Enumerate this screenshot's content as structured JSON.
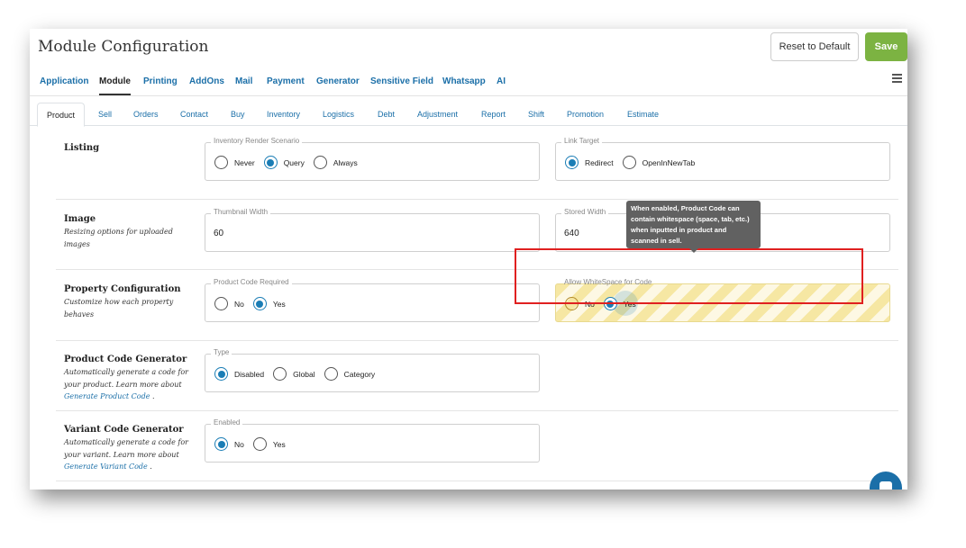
{
  "header": {
    "title": "Module Configuration",
    "reset_label": "Reset to Default",
    "save_label": "Save",
    "save_color": "#7cb342"
  },
  "topnav": {
    "items": [
      "Application",
      "Module",
      "Printing",
      "AddOns",
      "Mail",
      "Payment",
      "Generator",
      "Sensitive Field",
      "Whatsapp",
      "AI"
    ],
    "active": "Module",
    "menu_icon": "hamburger-icon"
  },
  "subtabs": {
    "items": [
      "Product",
      "Sell",
      "Orders",
      "Contact",
      "Buy",
      "Inventory",
      "Logistics",
      "Debt",
      "Adjustment",
      "Report",
      "Shift",
      "Promotion",
      "Estimate"
    ],
    "active": "Product"
  },
  "sections": {
    "listing": {
      "title": "Listing",
      "inventory_render": {
        "label": "Inventory Render Scenario",
        "options": [
          "Never",
          "Query",
          "Always"
        ],
        "selected": "Query"
      },
      "link_target": {
        "label": "Link Target",
        "options": [
          "Redirect",
          "OpenInNewTab"
        ],
        "selected": "Redirect"
      }
    },
    "image": {
      "title": "Image",
      "desc": "Resizing options for uploaded images",
      "thumbnail": {
        "label": "Thumbnail Width",
        "value": "60"
      },
      "stored": {
        "label": "Stored Width",
        "value": "640"
      }
    },
    "property": {
      "title": "Property Configuration",
      "desc": "Customize how each property behaves",
      "code_required": {
        "label": "Product Code Required",
        "options": [
          "No",
          "Yes"
        ],
        "selected": "Yes"
      },
      "whitespace": {
        "label": "Allow WhiteSpace for Code",
        "options": [
          "No",
          "Yes"
        ],
        "selected": "Yes"
      },
      "tooltip": "When enabled, Product Code can contain whitespace (space, tab, etc.) when inputted in product and scanned in sell."
    },
    "product_code_gen": {
      "title": "Product Code Generator",
      "desc_prefix": "Automatically generate a code for your product. Learn more about",
      "link": "Generate Product Code",
      "desc_suffix": " .",
      "type": {
        "label": "Type",
        "options": [
          "Disabled",
          "Global",
          "Category"
        ],
        "selected": "Disabled"
      }
    },
    "variant_code_gen": {
      "title": "Variant Code Generator",
      "desc_prefix": "Automatically generate a code for your variant. Learn more about",
      "link": "Generate Variant Code",
      "desc_suffix": " .",
      "enabled": {
        "label": "Enabled",
        "options": [
          "No",
          "Yes"
        ],
        "selected": "No"
      }
    }
  },
  "colors": {
    "link": "#1b6fa8",
    "radio_selected": "#1a7db5",
    "highlight_border": "#e02020"
  }
}
